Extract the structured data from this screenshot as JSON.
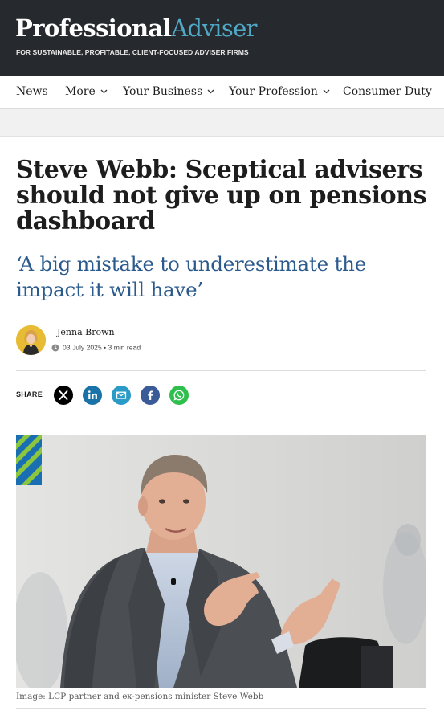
{
  "header": {
    "logo_part1": "Professional",
    "logo_part2": "Adviser",
    "tagline": "FOR SUSTAINABLE, PROFITABLE, CLIENT-FOCUSED ADVISER FIRMS"
  },
  "nav": {
    "items": [
      {
        "label": "News"
      },
      {
        "label": "More"
      },
      {
        "label": "Your Business"
      },
      {
        "label": "Your Profession"
      },
      {
        "label": "Consumer Duty"
      }
    ]
  },
  "article": {
    "title": "Steve Webb: Sceptical advisers should not give up on pensions dashboard",
    "subtitle": "‘A big mistake to underestimate the impact it will have’",
    "author": "Jenna Brown",
    "date": "03 July 2025",
    "read_time": "3 min read",
    "meta_separator": " • ",
    "share_label": "SHARE",
    "caption": "Image: LCP partner and ex-pensions minister Steve Webb"
  },
  "share": {
    "x": {
      "icon": "x-icon",
      "color": "#000000"
    },
    "linkedin": {
      "icon": "linkedin-icon",
      "color": "#1a73a8"
    },
    "email": {
      "icon": "email-icon",
      "color": "#2a9ac7"
    },
    "facebook": {
      "icon": "facebook-icon",
      "color": "#3a5a98"
    },
    "whatsapp": {
      "icon": "whatsapp-icon",
      "color": "#2fbf4f"
    }
  },
  "colors": {
    "header_bg": "#26292d",
    "logo_accent": "#4fa9c6",
    "subtitle": "#2b5a8c"
  }
}
